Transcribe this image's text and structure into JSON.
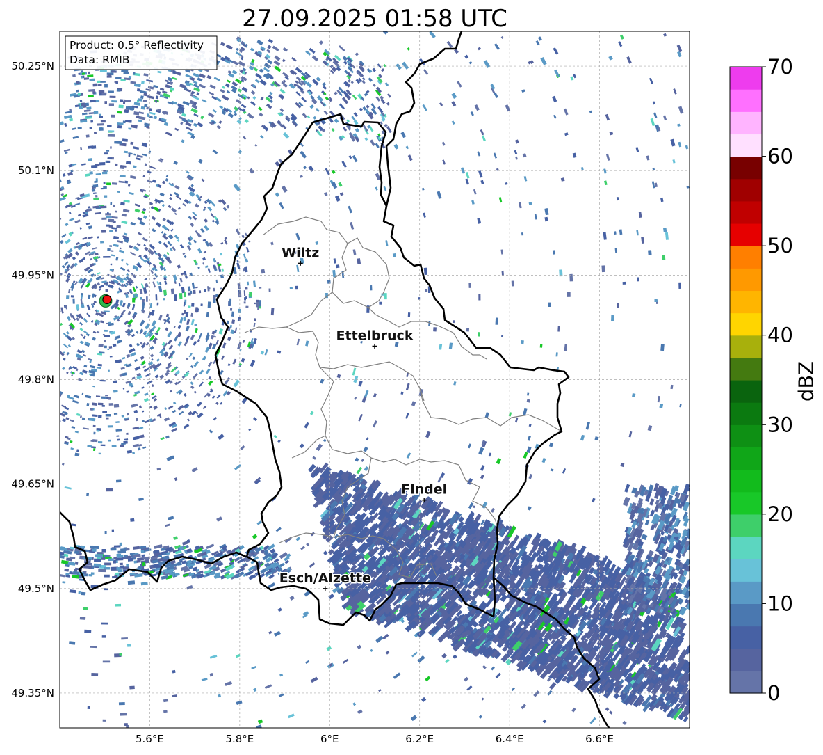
{
  "title": "27.09.2025 01:58 UTC",
  "info_box": {
    "product": "Product: 0.5° Reflectivity",
    "data": "Data: RMIB"
  },
  "map": {
    "lon_min": 5.4,
    "lon_max": 6.8,
    "lat_min": 49.3,
    "lat_max": 50.3,
    "lon_ticks": [
      {
        "value": 5.6,
        "label": "5.6°E"
      },
      {
        "value": 5.8,
        "label": "5.8°E"
      },
      {
        "value": 6.0,
        "label": "6°E"
      },
      {
        "value": 6.2,
        "label": "6.2°E"
      },
      {
        "value": 6.4,
        "label": "6.4°E"
      },
      {
        "value": 6.6,
        "label": "6.6°E"
      }
    ],
    "lat_ticks": [
      {
        "value": 50.25,
        "label": "50.25°N"
      },
      {
        "value": 50.1,
        "label": "50.1°N"
      },
      {
        "value": 49.95,
        "label": "49.95°N"
      },
      {
        "value": 49.8,
        "label": "49.8°N"
      },
      {
        "value": 49.65,
        "label": "49.65°N"
      },
      {
        "value": 49.5,
        "label": "49.5°N"
      },
      {
        "value": 49.35,
        "label": "49.35°N"
      }
    ],
    "radar_site": {
      "lon": 5.505,
      "lat": 49.915
    },
    "cities": [
      {
        "name": "Wiltz",
        "lon": 5.935,
        "lat": 49.967
      },
      {
        "name": "Ettelbruck",
        "lon": 6.1,
        "lat": 49.848
      },
      {
        "name": "Findel",
        "lon": 6.21,
        "lat": 49.627
      },
      {
        "name": "Esch/Alzette",
        "lon": 5.99,
        "lat": 49.5
      }
    ]
  },
  "colorbar": {
    "label": "dBZ",
    "min": 0,
    "max": 70,
    "ticks": [
      {
        "value": 0,
        "label": "0"
      },
      {
        "value": 10,
        "label": "10"
      },
      {
        "value": 20,
        "label": "20"
      },
      {
        "value": 30,
        "label": "30"
      },
      {
        "value": 40,
        "label": "40"
      },
      {
        "value": 50,
        "label": "50"
      },
      {
        "value": 60,
        "label": "60"
      },
      {
        "value": 70,
        "label": "70"
      }
    ],
    "colors": [
      "#6574a8",
      "#56649f",
      "#4761a4",
      "#4a78b0",
      "#5a9ac6",
      "#68c2d8",
      "#5cd6c0",
      "#3ecf6a",
      "#18c828",
      "#12bb1c",
      "#10a618",
      "#0e9014",
      "#0b7a10",
      "#0a640e",
      "#447a10",
      "#a8b00c",
      "#ffd500",
      "#ffb500",
      "#ff9900",
      "#ff7f00",
      "#e60000",
      "#c00000",
      "#a00000",
      "#780000",
      "#ffe0ff",
      "#ffb4ff",
      "#ff70ff",
      "#ee3cee"
    ]
  }
}
